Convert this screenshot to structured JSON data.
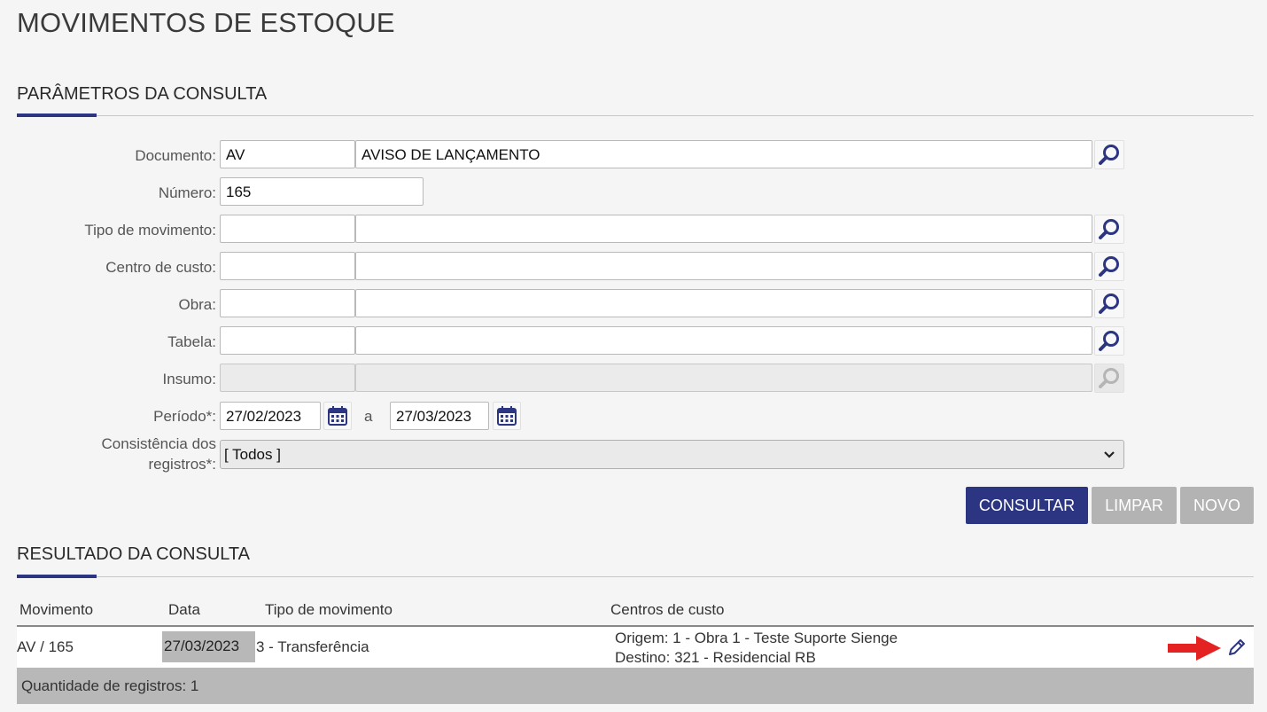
{
  "page": {
    "title": "MOVIMENTOS DE ESTOQUE"
  },
  "params": {
    "section_title": "PARÂMETROS DA CONSULTA",
    "documento": {
      "label": "Documento:",
      "code": "AV",
      "description": "AVISO DE LANÇAMENTO"
    },
    "numero": {
      "label": "Número:",
      "value": "165"
    },
    "tipo_movimento": {
      "label": "Tipo de movimento:",
      "code": "",
      "description": ""
    },
    "centro_custo": {
      "label": "Centro de custo:",
      "code": "",
      "description": ""
    },
    "obra": {
      "label": "Obra:",
      "code": "",
      "description": ""
    },
    "tabela": {
      "label": "Tabela:",
      "code": "",
      "description": ""
    },
    "insumo": {
      "label": "Insumo:",
      "code": "",
      "description": ""
    },
    "periodo": {
      "label": "Período*:",
      "start": "27/02/2023",
      "separator": "a",
      "end": "27/03/2023"
    },
    "consistencia": {
      "label": "Consistência dos registros*:",
      "selected": "[ Todos ]"
    }
  },
  "buttons": {
    "consultar": "CONSULTAR",
    "limpar": "LIMPAR",
    "novo": "NOVO"
  },
  "results": {
    "section_title": "RESULTADO DA CONSULTA",
    "columns": [
      "Movimento",
      "Data",
      "Tipo de movimento",
      "Centros de custo"
    ],
    "rows": [
      {
        "movimento": "AV / 165",
        "data": "27/03/2023",
        "tipo": "3 - Transferência",
        "centros": [
          "Origem: 1 - Obra 1 - Teste Suporte Sienge",
          "Destino: 321 - Residencial RB"
        ]
      }
    ],
    "count_label": "Quantidade de registros: 1"
  },
  "icons": {
    "search": "search-icon",
    "calendar": "calendar-icon",
    "edit": "pencil-icon",
    "annotation": "red-arrow-icon",
    "dropdown": "chevron-down-icon"
  },
  "colors": {
    "primary": "#2c3581",
    "secondary_button": "#b3b3b3",
    "annotation_arrow": "#e52222"
  }
}
